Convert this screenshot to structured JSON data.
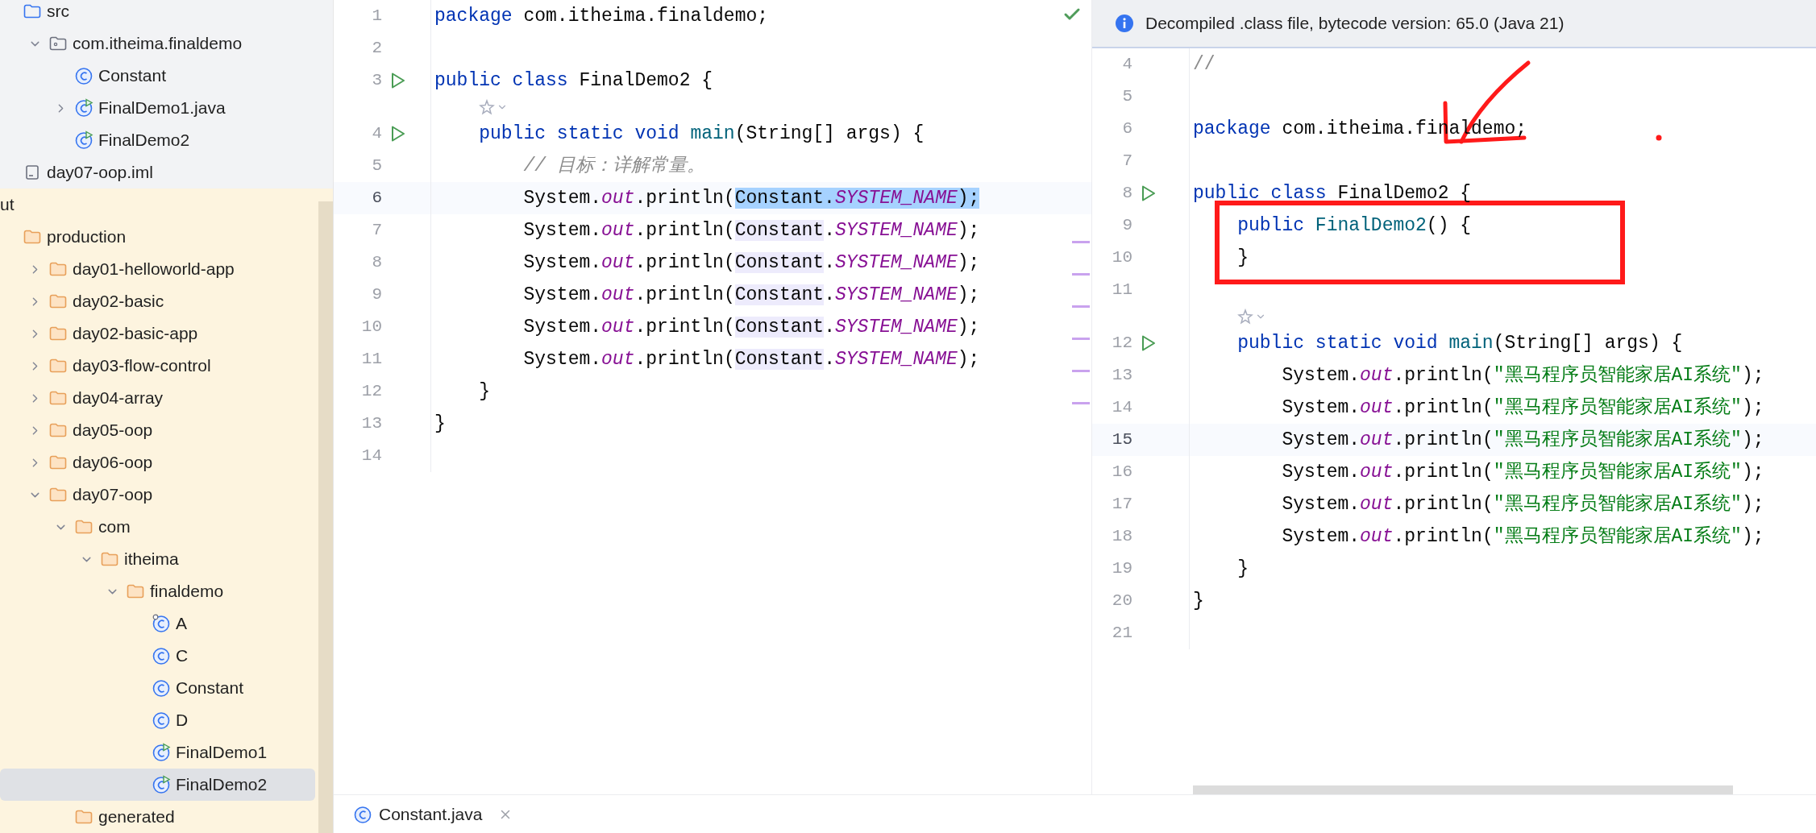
{
  "sidebar": {
    "module_children": [
      {
        "label": "src",
        "kind": "folder-blue",
        "selected": false,
        "excluded": false,
        "children": [
          {
            "label": "com.itheima.finaldemo",
            "kind": "package",
            "expanded": true,
            "selected": false,
            "children": [
              {
                "label": "Constant",
                "kind": "class",
                "selected": false
              },
              {
                "label": "FinalDemo1.java",
                "kind": "runnable-class",
                "expanded": false,
                "selected": false
              },
              {
                "label": "FinalDemo2",
                "kind": "runnable-class",
                "selected": false
              }
            ]
          }
        ]
      },
      {
        "label": "day07-oop.iml",
        "kind": "file",
        "selected": false,
        "excluded": false
      }
    ],
    "tree": [
      {
        "label": "ut",
        "kind": "cut-label",
        "selected": false,
        "excluded": true,
        "children": [
          {
            "label": "production",
            "kind": "folder",
            "selected": false,
            "children": [
              {
                "label": "day01-helloworld-app",
                "kind": "folder",
                "expanded": false,
                "selected": false
              },
              {
                "label": "day02-basic",
                "kind": "folder",
                "expanded": false,
                "selected": false
              },
              {
                "label": "day02-basic-app",
                "kind": "folder",
                "expanded": false,
                "selected": false
              },
              {
                "label": "day03-flow-control",
                "kind": "folder",
                "expanded": false,
                "selected": false
              },
              {
                "label": "day04-array",
                "kind": "folder",
                "expanded": false,
                "selected": false
              },
              {
                "label": "day05-oop",
                "kind": "folder",
                "expanded": false,
                "selected": false
              },
              {
                "label": "day06-oop",
                "kind": "folder",
                "expanded": false,
                "selected": false
              },
              {
                "label": "day07-oop",
                "kind": "folder",
                "expanded": true,
                "selected": false,
                "children": [
                  {
                    "label": "com",
                    "kind": "folder",
                    "expanded": true,
                    "selected": false,
                    "children": [
                      {
                        "label": "itheima",
                        "kind": "folder",
                        "expanded": true,
                        "selected": false,
                        "children": [
                          {
                            "label": "finaldemo",
                            "kind": "folder",
                            "expanded": true,
                            "selected": false,
                            "children": [
                              {
                                "label": "A",
                                "kind": "class-marked",
                                "selected": false
                              },
                              {
                                "label": "C",
                                "kind": "class",
                                "selected": false
                              },
                              {
                                "label": "Constant",
                                "kind": "class",
                                "selected": false
                              },
                              {
                                "label": "D",
                                "kind": "class",
                                "selected": false
                              },
                              {
                                "label": "FinalDemo1",
                                "kind": "runnable-class",
                                "selected": false
                              },
                              {
                                "label": "FinalDemo2",
                                "kind": "runnable-class",
                                "selected": true
                              }
                            ]
                          }
                        ]
                      }
                    ]
                  },
                  {
                    "label": "generated",
                    "kind": "folder",
                    "selected": false
                  }
                ]
              }
            ]
          }
        ]
      }
    ]
  },
  "left_editor": {
    "lines": [
      {
        "kind": "code",
        "number": "1",
        "run": false,
        "current": false,
        "tokens": [
          {
            "kind": "keyword",
            "text": "package "
          },
          {
            "kind": "plain",
            "text": "com.itheima.finaldemo;"
          }
        ]
      },
      {
        "kind": "code",
        "number": "2",
        "run": false,
        "current": false
      },
      {
        "kind": "code",
        "number": "3",
        "run": true,
        "current": false,
        "tokens": [
          {
            "kind": "keyword",
            "text": "public class "
          },
          {
            "kind": "plain",
            "text": "FinalDemo2 {"
          }
        ]
      },
      {
        "kind": "hint"
      },
      {
        "kind": "code",
        "number": "4",
        "run": true,
        "current": false,
        "tokens": [
          {
            "kind": "keyword",
            "text": "    public static void "
          },
          {
            "kind": "method",
            "text": "main"
          },
          {
            "kind": "plain",
            "text": "(String[] args) {"
          }
        ]
      },
      {
        "kind": "code",
        "number": "5",
        "run": false,
        "current": false,
        "tokens": [
          {
            "kind": "comment",
            "text": "        // 目标：详解常量。"
          }
        ]
      },
      {
        "kind": "code",
        "number": "6",
        "run": false,
        "current": true,
        "tokens": [
          {
            "kind": "plain",
            "text": "        System."
          },
          {
            "kind": "field",
            "text": "out"
          },
          {
            "kind": "plain",
            "text": ".println("
          }
        ],
        "selection": [
          {
            "kind": "plain",
            "text": "Constant."
          },
          {
            "kind": "field",
            "text": "SYSTEM_NAME"
          },
          {
            "kind": "plain",
            "text": ");"
          }
        ]
      },
      {
        "kind": "code",
        "number": "7",
        "run": false,
        "current": false,
        "tokens": [
          {
            "kind": "plain",
            "text": "        System."
          },
          {
            "kind": "field",
            "text": "out"
          },
          {
            "kind": "plain",
            "text": ".println("
          },
          {
            "kind": "usage",
            "text": "Constant"
          },
          {
            "kind": "plain",
            "text": "."
          },
          {
            "kind": "field",
            "text": "SYSTEM_NAME"
          },
          {
            "kind": "plain",
            "text": ");"
          }
        ]
      },
      {
        "kind": "code",
        "number": "8",
        "run": false,
        "current": false,
        "tokens": [
          {
            "kind": "plain",
            "text": "        System."
          },
          {
            "kind": "field",
            "text": "out"
          },
          {
            "kind": "plain",
            "text": ".println("
          },
          {
            "kind": "usage",
            "text": "Constant"
          },
          {
            "kind": "plain",
            "text": "."
          },
          {
            "kind": "field",
            "text": "SYSTEM_NAME"
          },
          {
            "kind": "plain",
            "text": ");"
          }
        ]
      },
      {
        "kind": "code",
        "number": "9",
        "run": false,
        "current": false,
        "tokens": [
          {
            "kind": "plain",
            "text": "        System."
          },
          {
            "kind": "field",
            "text": "out"
          },
          {
            "kind": "plain",
            "text": ".println("
          },
          {
            "kind": "usage",
            "text": "Constant"
          },
          {
            "kind": "plain",
            "text": "."
          },
          {
            "kind": "field",
            "text": "SYSTEM_NAME"
          },
          {
            "kind": "plain",
            "text": ");"
          }
        ]
      },
      {
        "kind": "code",
        "number": "10",
        "run": false,
        "current": false,
        "tokens": [
          {
            "kind": "plain",
            "text": "        System."
          },
          {
            "kind": "field",
            "text": "out"
          },
          {
            "kind": "plain",
            "text": ".println("
          },
          {
            "kind": "usage",
            "text": "Constant"
          },
          {
            "kind": "plain",
            "text": "."
          },
          {
            "kind": "field",
            "text": "SYSTEM_NAME"
          },
          {
            "kind": "plain",
            "text": ");"
          }
        ]
      },
      {
        "kind": "code",
        "number": "11",
        "run": false,
        "current": false,
        "tokens": [
          {
            "kind": "plain",
            "text": "        System."
          },
          {
            "kind": "field",
            "text": "out"
          },
          {
            "kind": "plain",
            "text": ".println("
          },
          {
            "kind": "usage",
            "text": "Constant"
          },
          {
            "kind": "plain",
            "text": "."
          },
          {
            "kind": "field",
            "text": "SYSTEM_NAME"
          },
          {
            "kind": "plain",
            "text": ");"
          }
        ]
      },
      {
        "kind": "code",
        "number": "12",
        "run": false,
        "current": false,
        "tokens": [
          {
            "kind": "plain",
            "text": "    }"
          }
        ]
      },
      {
        "kind": "code",
        "number": "13",
        "run": false,
        "current": false,
        "tokens": [
          {
            "kind": "plain",
            "text": "}"
          }
        ]
      },
      {
        "kind": "code",
        "number": "14",
        "run": false,
        "current": false
      }
    ]
  },
  "right_editor": {
    "banner": "Decompiled .class file, bytecode version: 65.0 (Java 21)",
    "lines": [
      {
        "kind": "code",
        "number": "4",
        "run": false,
        "current": false,
        "tokens": [
          {
            "kind": "comment-plain",
            "text": "//"
          }
        ]
      },
      {
        "kind": "code",
        "number": "5",
        "run": false,
        "current": false
      },
      {
        "kind": "code",
        "number": "6",
        "run": false,
        "current": false,
        "tokens": [
          {
            "kind": "keyword",
            "text": "package "
          },
          {
            "kind": "plain",
            "text": "com.itheima.finaldemo;"
          }
        ]
      },
      {
        "kind": "code",
        "number": "7",
        "run": false,
        "current": false
      },
      {
        "kind": "code",
        "number": "8",
        "run": true,
        "current": false,
        "tokens": [
          {
            "kind": "keyword",
            "text": "public class "
          },
          {
            "kind": "plain",
            "text": "FinalDemo2 {"
          }
        ]
      },
      {
        "kind": "code",
        "number": "9",
        "run": false,
        "current": false,
        "tokens": [
          {
            "kind": "keyword",
            "text": "    public "
          },
          {
            "kind": "method",
            "text": "FinalDemo2"
          },
          {
            "kind": "plain",
            "text": "() {"
          }
        ]
      },
      {
        "kind": "code",
        "number": "10",
        "run": false,
        "current": false,
        "tokens": [
          {
            "kind": "plain",
            "text": "    }"
          }
        ]
      },
      {
        "kind": "code",
        "number": "11",
        "run": false,
        "current": false
      },
      {
        "kind": "hint"
      },
      {
        "kind": "code",
        "number": "12",
        "run": true,
        "current": false,
        "tokens": [
          {
            "kind": "keyword",
            "text": "    public static void "
          },
          {
            "kind": "method",
            "text": "main"
          },
          {
            "kind": "plain",
            "text": "(String[] args) {"
          }
        ]
      },
      {
        "kind": "code",
        "number": "13",
        "run": false,
        "current": false,
        "tokens": [
          {
            "kind": "plain",
            "text": "        System."
          },
          {
            "kind": "field",
            "text": "out"
          },
          {
            "kind": "plain",
            "text": ".println("
          },
          {
            "kind": "string",
            "text": "\"黑马程序员智能家居AI系统\""
          },
          {
            "kind": "plain",
            "text": ");"
          }
        ]
      },
      {
        "kind": "code",
        "number": "14",
        "run": false,
        "current": false,
        "tokens": [
          {
            "kind": "plain",
            "text": "        System."
          },
          {
            "kind": "field",
            "text": "out"
          },
          {
            "kind": "plain",
            "text": ".println("
          },
          {
            "kind": "string",
            "text": "\"黑马程序员智能家居AI系统\""
          },
          {
            "kind": "plain",
            "text": ");"
          }
        ]
      },
      {
        "kind": "code",
        "number": "15",
        "run": false,
        "current": true,
        "tokens": [
          {
            "kind": "plain",
            "text": "        System."
          },
          {
            "kind": "field",
            "text": "out"
          },
          {
            "kind": "plain",
            "text": ".println("
          },
          {
            "kind": "string",
            "text": "\"黑马程序员智能家居AI系统\""
          },
          {
            "kind": "plain",
            "text": ");"
          }
        ]
      },
      {
        "kind": "code",
        "number": "16",
        "run": false,
        "current": false,
        "tokens": [
          {
            "kind": "plain",
            "text": "        System."
          },
          {
            "kind": "field",
            "text": "out"
          },
          {
            "kind": "plain",
            "text": ".println("
          },
          {
            "kind": "string",
            "text": "\"黑马程序员智能家居AI系统\""
          },
          {
            "kind": "plain",
            "text": ");"
          }
        ]
      },
      {
        "kind": "code",
        "number": "17",
        "run": false,
        "current": false,
        "tokens": [
          {
            "kind": "plain",
            "text": "        System."
          },
          {
            "kind": "field",
            "text": "out"
          },
          {
            "kind": "plain",
            "text": ".println("
          },
          {
            "kind": "string",
            "text": "\"黑马程序员智能家居AI系统\""
          },
          {
            "kind": "plain",
            "text": ");"
          }
        ]
      },
      {
        "kind": "code",
        "number": "18",
        "run": false,
        "current": false,
        "tokens": [
          {
            "kind": "plain",
            "text": "        System."
          },
          {
            "kind": "field",
            "text": "out"
          },
          {
            "kind": "plain",
            "text": ".println("
          },
          {
            "kind": "string",
            "text": "\"黑马程序员智能家居AI系统\""
          },
          {
            "kind": "plain",
            "text": ");"
          }
        ]
      },
      {
        "kind": "code",
        "number": "19",
        "run": false,
        "current": false,
        "tokens": [
          {
            "kind": "plain",
            "text": "    }"
          }
        ]
      },
      {
        "kind": "code",
        "number": "20",
        "run": false,
        "current": false,
        "tokens": [
          {
            "kind": "plain",
            "text": "}"
          }
        ]
      },
      {
        "kind": "code",
        "number": "21",
        "run": false,
        "current": false
      }
    ]
  },
  "tabs": [
    {
      "label": "Constant.java",
      "kind": "class",
      "selected": false
    }
  ]
}
